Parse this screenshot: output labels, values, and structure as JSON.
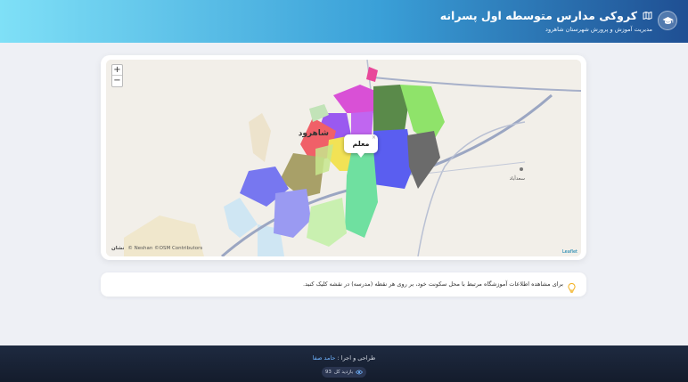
{
  "header": {
    "title": "کروکی مدارس متوسطه اول پسرانه",
    "subtitle": "مدیریت آموزش و پرورش شهرستان شاهرود",
    "logo_icon": "graduation-cap-icon",
    "title_icon": "map-icon"
  },
  "map": {
    "zoom_in_label": "+",
    "zoom_out_label": "−",
    "popup_text": "معلم",
    "popup_close": "×",
    "attribution": "Leaflet",
    "watermark_brand": "نشان",
    "watermark_credit": "© Neshan ©OSM Contributors",
    "city_label": "شاهرود",
    "village_label": "سعدآباد"
  },
  "info": {
    "icon": "lightbulb-icon",
    "text": "برای مشاهده اطلاعات آموزشگاه مرتبط با محل سکونت خود، بر روی هر نقطه (مدرسه) در نقشه کلیک کنید."
  },
  "footer": {
    "credit_prefix": "طراحی و اجرا :",
    "author": "حامد صفا",
    "visits_label": "بازدید کل",
    "visits_count": "93",
    "visits_icon": "eye-icon"
  },
  "colors": {
    "header_start": "#7fe0f7",
    "header_end": "#1f4f93",
    "footer_bg": "#1a2336",
    "info_icon": "#f2b01e"
  }
}
